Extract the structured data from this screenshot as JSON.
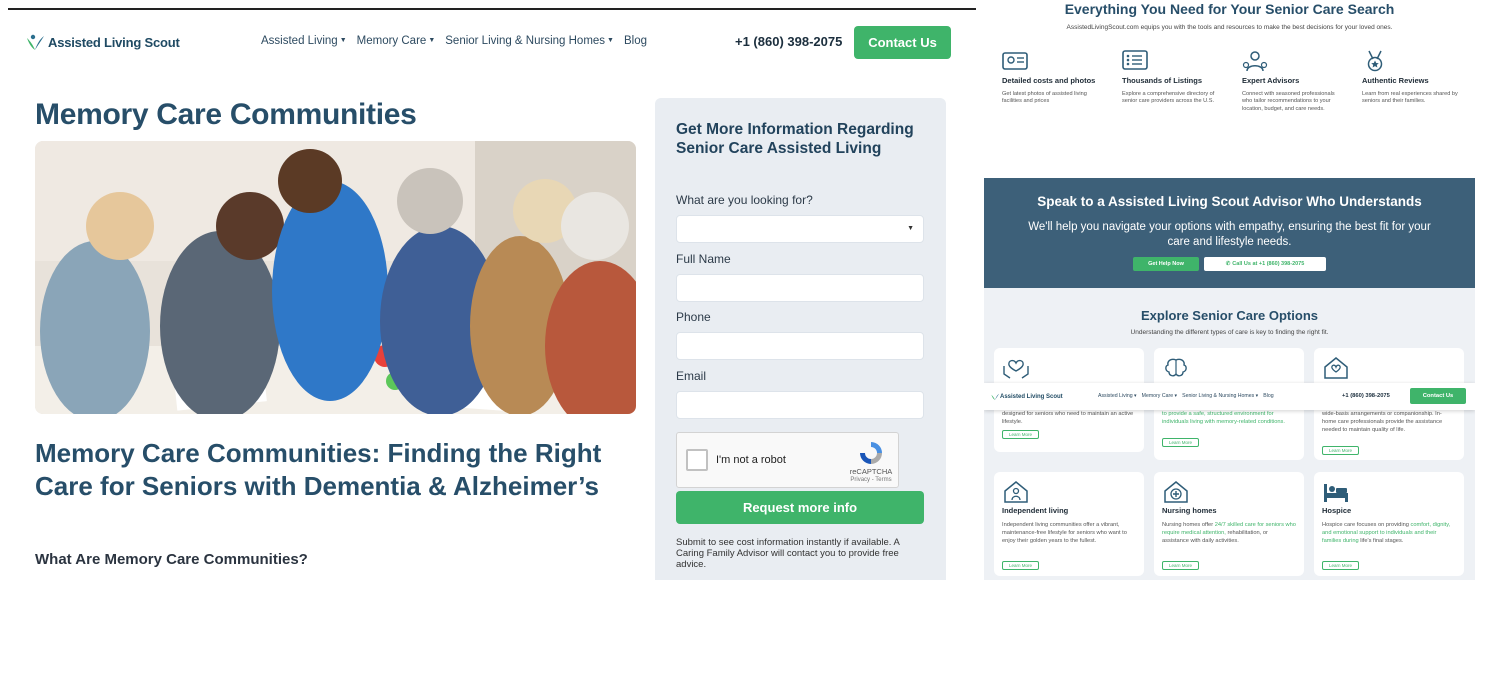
{
  "left": {
    "logo_text": "Assisted Living Scout",
    "nav": [
      {
        "label": "Assisted Living",
        "dropdown": true
      },
      {
        "label": "Memory Care",
        "dropdown": true
      },
      {
        "label": "Senior Living & Nursing Homes",
        "dropdown": true
      },
      {
        "label": "Blog",
        "dropdown": false
      }
    ],
    "phone": "+1 (860) 398-2075",
    "contact_label": "Contact Us",
    "page_title": "Memory Care Communities",
    "article_title": "Memory Care Communities: Finding the Right Care for Seniors with Dementia & Alzheimer’s",
    "section_heading": "What Are Memory Care Communities?",
    "form": {
      "title": "Get More Information Regarding Senior Care Assisted Living",
      "looking_for_label": "What are you looking for?",
      "looking_for_value": "",
      "full_name_label": "Full Name",
      "phone_label": "Phone",
      "email_label": "Email",
      "captcha_label": "I'm not a robot",
      "captcha_brand": "reCAPTCHA",
      "captcha_links": "Privacy - Terms",
      "submit_label": "Request more info",
      "note": "Submit to see cost information instantly if available. A Caring Family Advisor will contact you to provide free advice."
    }
  },
  "right": {
    "headline": "Everything You Need for Your Senior Care Search",
    "subline": "AssistedLivingScout.com equips you with the tools and resources to make the best decisions for your loved ones.",
    "features": [
      {
        "icon": "photo-card-icon",
        "title": "Detailed costs and photos",
        "desc": "Get latest photos of assisted living facilities and prices"
      },
      {
        "icon": "list-icon",
        "title": "Thousands of Listings",
        "desc": "Explore a comprehensive directory of senior care providers across the U.S."
      },
      {
        "icon": "advisor-icon",
        "title": "Expert Advisors",
        "desc": "Connect with seasoned professionals who tailor recommendations to your location, budget, and care needs."
      },
      {
        "icon": "medal-icon",
        "title": "Authentic Reviews",
        "desc": "Learn from real experiences shared by seniors and their families."
      }
    ],
    "advisor": {
      "title": "Speak to a Assisted Living Scout Advisor Who Understands",
      "subtitle": "We'll help you navigate your options with empathy, ensuring the best fit for your care and lifestyle needs.",
      "help_label": "Get Help Now",
      "call_label": "Call Us at +1 (860) 398-2075"
    },
    "explore": {
      "title": "Explore Senior Care Options",
      "subtitle": "Understanding the different types of care is key to finding the right fit.",
      "cards_top": [
        {
          "icon": "hands-heart-icon",
          "desc_visible": "designed for seniors who need to maintain an active lifestyle.",
          "learn": "Learn More"
        },
        {
          "icon": "brain-icon",
          "desc_visible": "to provide a safe, structured environment for individuals living with memory-related conditions.",
          "learn": "Learn More"
        },
        {
          "icon": "home-heart-icon",
          "desc_visible": "wide-basis arrangements or companionship. In-home care professionals provide the assistance needed to maintain quality of life.",
          "learn": "Learn More"
        }
      ],
      "cards_bottom": [
        {
          "icon": "house-person-icon",
          "title": "Independent living",
          "desc": "Independent living communities offer a vibrant, maintenance-free lifestyle for seniors who want to enjoy their golden years to the fullest.",
          "learn": "Learn More"
        },
        {
          "icon": "medical-cross-icon",
          "title": "Nursing homes",
          "desc_a": "Nursing homes offer ",
          "desc_b": "24/7 skilled care for seniors who require medical attention,",
          "desc_c": " rehabilitation, or assistance with daily activities.",
          "learn": "Learn More"
        },
        {
          "icon": "bed-icon",
          "title": "Hospice",
          "desc_a": "Hospice care focuses on providing ",
          "desc_b": "comfort, dignity, and emotional support to individuals and their families during",
          "desc_c": " life's final stages.",
          "learn": "Learn More"
        }
      ]
    },
    "sticky": {
      "logo_text": "Assisted Living Scout",
      "nav": [
        "Assisted Living ▾",
        "Memory Care ▾",
        "Senior Living & Nursing Homes ▾",
        "Blog"
      ],
      "phone": "+1 (860) 398-2075",
      "contact_label": "Contact Us"
    }
  },
  "colors": {
    "brand_green": "#3fb46a",
    "heading_blue": "#274e69",
    "banner_blue": "#3d6079"
  }
}
